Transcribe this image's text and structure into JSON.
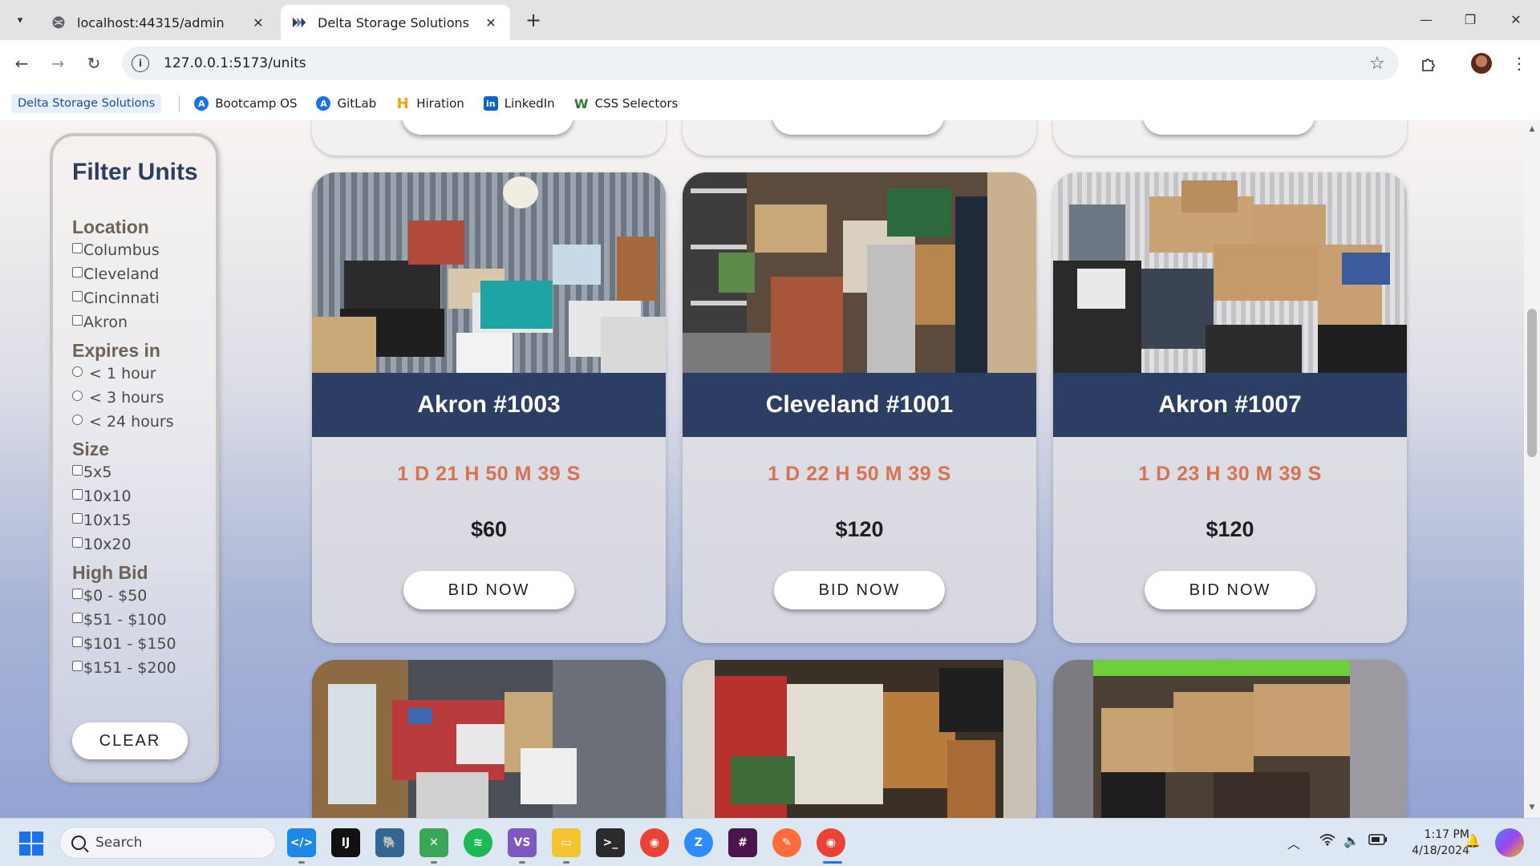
{
  "browser": {
    "tabs": [
      {
        "title": "localhost:44315/admin",
        "active": false,
        "favicon": "globe-icon"
      },
      {
        "title": "Delta Storage Solutions",
        "active": true,
        "favicon": "delta-logo-icon"
      }
    ],
    "url": "127.0.0.1:5173/units",
    "bookmarks": [
      {
        "label": "Delta Storage Solutions"
      },
      {
        "label": "Bootcamp OS"
      },
      {
        "label": "GitLab"
      },
      {
        "label": "Hiration"
      },
      {
        "label": "LinkedIn"
      },
      {
        "label": "CSS Selectors"
      }
    ]
  },
  "filters": {
    "title": "Filter Units",
    "location": {
      "heading": "Location",
      "options": [
        "Columbus",
        "Cleveland",
        "Cincinnati",
        "Akron"
      ]
    },
    "expires": {
      "heading": "Expires in",
      "options": [
        "< 1 hour",
        "< 3 hours",
        "< 24 hours"
      ]
    },
    "size": {
      "heading": "Size",
      "options": [
        "5x5",
        "10x10",
        "10x15",
        "10x20"
      ]
    },
    "high_bid": {
      "heading": "High Bid",
      "options": [
        "$0 - $50",
        "$51 - $100",
        "$101 - $150",
        "$151 - $200"
      ]
    },
    "clear_label": "CLEAR"
  },
  "units": [
    {
      "title": "Akron #1003",
      "timer": "1 D 21 H 50 M 39 S",
      "price": "$60",
      "bid_label": "BID NOW"
    },
    {
      "title": "Cleveland #1001",
      "timer": "1 D 22 H 50 M 39 S",
      "price": "$120",
      "bid_label": "BID NOW"
    },
    {
      "title": "Akron #1007",
      "timer": "1 D 23 H 30 M 39 S",
      "price": "$120",
      "bid_label": "BID NOW"
    }
  ],
  "taskbar": {
    "search_placeholder": "Search",
    "time": "1:17 PM",
    "date": "4/18/2024"
  },
  "colors": {
    "card_title_bg": "#2c3e63",
    "timer": "#d9724f",
    "filter_title": "#2c3e60"
  }
}
